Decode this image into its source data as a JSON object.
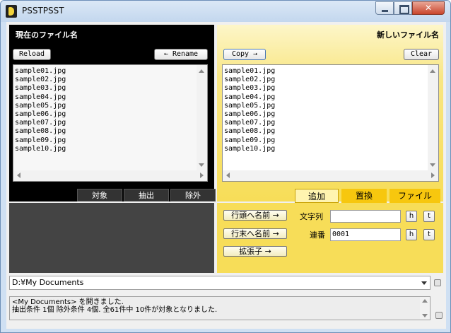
{
  "window": {
    "title": "PSSTPSST"
  },
  "left": {
    "header": "現在のファイル名",
    "reload_label": "Reload",
    "rename_label": "← Rename",
    "files": [
      "sample01.jpg",
      "sample02.jpg",
      "sample03.jpg",
      "sample04.jpg",
      "sample05.jpg",
      "sample06.jpg",
      "sample07.jpg",
      "sample08.jpg",
      "sample09.jpg",
      "sample10.jpg"
    ],
    "tabs": [
      "対象",
      "抽出",
      "除外"
    ]
  },
  "right": {
    "header": "新しいファイル名",
    "copy_label": "Copy →",
    "clear_label": "Clear",
    "files": [
      "sample01.jpg",
      "sample02.jpg",
      "sample03.jpg",
      "sample04.jpg",
      "sample05.jpg",
      "sample06.jpg",
      "sample07.jpg",
      "sample08.jpg",
      "sample09.jpg",
      "sample10.jpg"
    ],
    "tabs": [
      "追加",
      "置換",
      "ファイル"
    ],
    "actions": {
      "prepend_label": "行頭へ名前 →",
      "append_label": "行末へ名前 →",
      "extension_label": "拡張子 →"
    },
    "fields": {
      "string_label": "文字列",
      "string_value": "",
      "serial_label": "連番",
      "serial_value": "0001",
      "h_label": "h",
      "t_label": "t"
    }
  },
  "path": {
    "value": "D:¥My Documents"
  },
  "log": {
    "line1": "<My Documents> を開きました.",
    "line2": "抽出条件 1個 除外条件 4個. 全61件中 10件が対象となりました."
  }
}
